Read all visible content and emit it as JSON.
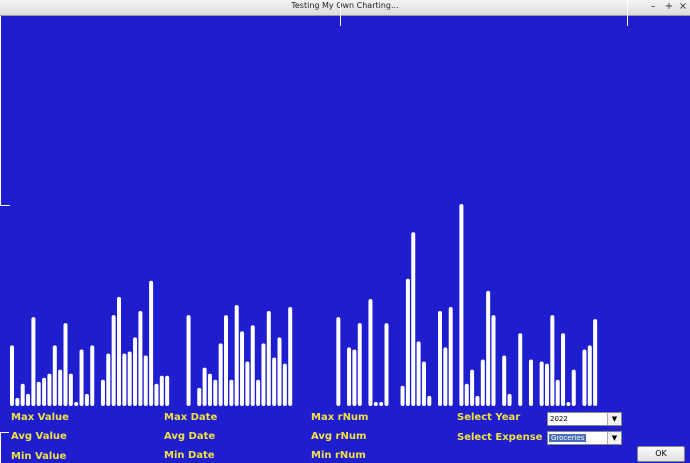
{
  "window": {
    "title": "Testing My Own Charting...",
    "minimize": "–",
    "maximize": "+",
    "close": "×"
  },
  "stats": {
    "max_value": "Max Value",
    "avg_value": "Avg Value",
    "min_value": "Min Value",
    "max_date": "Max Date",
    "avg_date": "Avg Date",
    "min_date": "Min Date",
    "max_rnum": "Max rNum",
    "avg_rnum": "Avg rNum",
    "min_rnum": "Min rNum"
  },
  "controls": {
    "select_year_label": "Select Year",
    "year_value": "2022",
    "select_expense_label": "Select Expense",
    "expense_value": "Groceries",
    "ok_label": "OK"
  },
  "colors": {
    "background": "#1e1ecf",
    "bars": "#ffffff",
    "labels": "#f0e040"
  },
  "chart_data": {
    "type": "bar",
    "xlabel": "",
    "ylabel": "",
    "ylim": [
      0,
      100
    ],
    "series": [
      {
        "values": [
          30,
          4,
          11,
          6,
          44,
          12,
          14,
          16,
          30,
          18,
          41,
          16,
          2,
          28,
          6,
          30,
          0,
          13,
          26,
          45,
          54,
          26,
          27,
          34,
          47,
          25,
          62,
          11,
          15,
          15,
          0,
          0,
          0,
          45,
          0,
          9,
          19,
          16,
          13,
          31,
          45,
          13,
          50,
          37,
          22,
          40,
          13,
          31,
          47,
          24,
          34,
          21,
          49,
          0,
          0,
          0,
          0,
          0,
          0,
          0,
          0,
          44,
          0,
          29,
          28,
          41,
          0,
          53,
          2,
          2,
          41,
          0,
          0,
          10,
          63,
          86,
          32,
          22,
          5,
          0,
          47,
          29,
          49,
          0,
          100,
          11,
          18,
          5,
          23,
          57,
          45,
          0,
          25,
          6,
          0,
          36,
          0,
          23,
          0,
          22,
          21,
          45,
          13,
          36,
          2,
          18,
          0,
          28,
          30,
          43
        ]
      }
    ]
  }
}
